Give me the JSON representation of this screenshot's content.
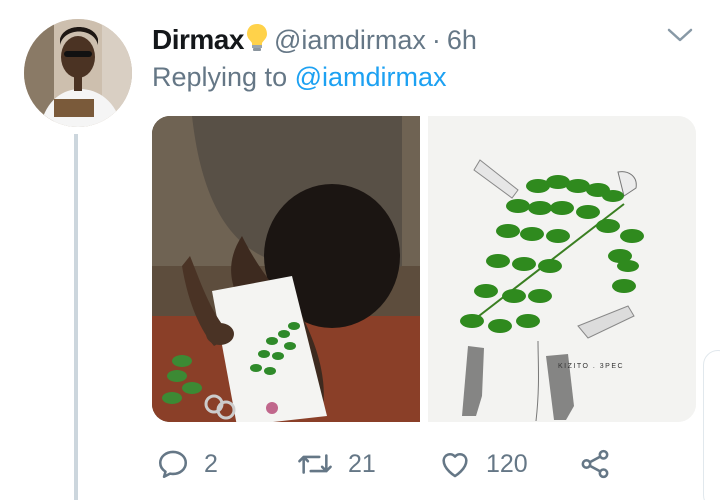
{
  "tweet": {
    "display_name": "Dirmax",
    "emoji": "💡",
    "handle": "@iamdirmax",
    "separator": "·",
    "time": "6h",
    "replying_prefix": "Replying to",
    "replying_handle": "@iamdirmax"
  },
  "media": {
    "left_photo_icon": "photo-student-drawing",
    "right_photo_icon": "photo-leaf-dress-illustration",
    "signature": "KIZITO . 3PEC"
  },
  "actions": {
    "reply_count": "2",
    "retweet_count": "21",
    "like_count": "120"
  },
  "colors": {
    "text_primary": "#14171a",
    "text_secondary": "#657786",
    "link": "#1da1f2",
    "divider": "#ccd6dd"
  }
}
